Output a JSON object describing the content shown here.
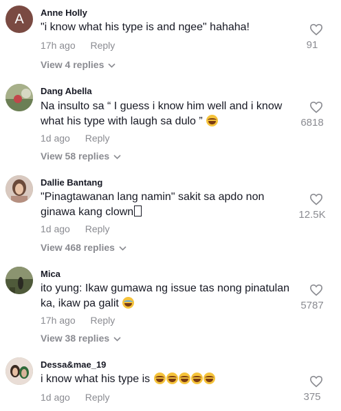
{
  "comments": [
    {
      "avatar_letter": "A",
      "username": "Anne Holly",
      "text": "\"i know what his type is and ngee\" hahaha!",
      "time": "17h ago",
      "reply_label": "Reply",
      "replies_label": "View 4 replies",
      "likes": "91"
    },
    {
      "username": "Dang Abella",
      "text": "Na insulto sa “ I guess i know him well and i know what his type with laugh sa dulo ”",
      "time": "1d ago",
      "reply_label": "Reply",
      "replies_label": "View 58 replies",
      "likes": "6818"
    },
    {
      "username": "Dallie Bantang",
      "text": "\"Pinagtawanan lang namin\" sakit sa apdo non ginawa kang clown",
      "time": "1d ago",
      "reply_label": "Reply",
      "replies_label": "View 468 replies",
      "likes": "12.5K"
    },
    {
      "username": "M⁠ica",
      "text": "ito yung: Ikaw gumawa ng issue tas nong pinatulan ka, ikaw pa galit",
      "time": "17h ago",
      "reply_label": "Reply",
      "replies_label": "View 38 replies",
      "likes": "5787"
    },
    {
      "username": "Dessa&mae_19",
      "text": "i know what his type is",
      "time": "1d ago",
      "reply_label": "Reply",
      "likes": "375"
    }
  ],
  "icons": {
    "heart": "heart-outline-icon",
    "chevron": "chevron-down-icon",
    "laugh_emoji": "face-with-tears-of-joy-emoji",
    "cry_emoji": "loudly-crying-face-emoji"
  },
  "colors": {
    "text": "#161823",
    "muted": "#8a8b91",
    "avatar_letter_bg": "#7a4a42"
  }
}
